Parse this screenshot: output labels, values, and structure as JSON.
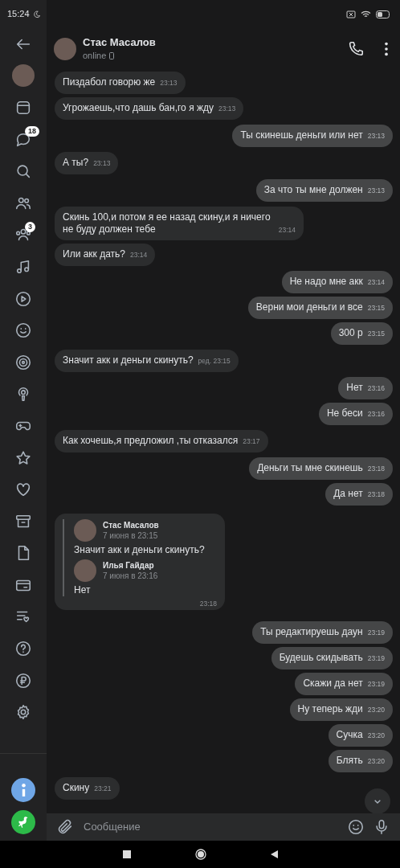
{
  "status_bar": {
    "time": "15:24"
  },
  "sidebar": {
    "items": [
      {
        "kind": "back"
      },
      {
        "kind": "avatar"
      },
      {
        "kind": "window"
      },
      {
        "kind": "chat",
        "badge": "18"
      },
      {
        "kind": "search"
      },
      {
        "kind": "people"
      },
      {
        "kind": "groups",
        "badge": "3"
      },
      {
        "kind": "music"
      },
      {
        "kind": "play"
      },
      {
        "kind": "smile"
      },
      {
        "kind": "target"
      },
      {
        "kind": "podcast"
      },
      {
        "kind": "gamepad"
      },
      {
        "kind": "star"
      },
      {
        "kind": "heart"
      },
      {
        "kind": "archive"
      },
      {
        "kind": "document"
      },
      {
        "kind": "card"
      },
      {
        "kind": "list"
      },
      {
        "kind": "question"
      },
      {
        "kind": "ruble"
      },
      {
        "kind": "gear"
      }
    ],
    "bottom_items": [
      {
        "kind": "info",
        "color": "#6fa6e6"
      },
      {
        "kind": "bird",
        "color": "#2dba49"
      }
    ]
  },
  "header": {
    "name": "Стас Масалов",
    "status": "online"
  },
  "messages": [
    {
      "outgoing": false,
      "text": "Пиздабол говорю же",
      "time": "23:13"
    },
    {
      "outgoing": false,
      "text": "Угрожаешь,что дашь бан,го я жду",
      "time": "23:13"
    },
    {
      "outgoing": true,
      "text": "Ты скинешь деньги или нет",
      "time": "23:13"
    },
    {
      "outgoing": false,
      "text": "А ты?",
      "time": "23:13"
    },
    {
      "outgoing": true,
      "text": "За что ты мне должен",
      "time": "23:13"
    },
    {
      "outgoing": false,
      "text": "Скинь 100,и потом я ее назад скину,и я ничего не буду должен тебе",
      "time": "23:14"
    },
    {
      "outgoing": false,
      "text": "Или акк дать?",
      "time": "23:14"
    },
    {
      "outgoing": true,
      "text": "Не надо мне акк",
      "time": "23:14"
    },
    {
      "outgoing": true,
      "text": "Верни мои деньги и все",
      "time": "23:15"
    },
    {
      "outgoing": true,
      "text": "300 р",
      "time": "23:15"
    },
    {
      "outgoing": false,
      "text": "Значит акк и деньги скинуть?",
      "time": "ред. 23:15"
    },
    {
      "outgoing": true,
      "text": "Нет",
      "time": "23:16"
    },
    {
      "outgoing": true,
      "text": "Не беси",
      "time": "23:16"
    },
    {
      "outgoing": false,
      "text": "Как хочешь,я предложил ,ты отказался",
      "time": "23:17"
    },
    {
      "outgoing": true,
      "text": "Деньги ты мне скинешь",
      "time": "23:18"
    },
    {
      "outgoing": true,
      "text": "Да нет",
      "time": "23:18"
    },
    {
      "outgoing": false,
      "time": "23:18",
      "forwarded": [
        {
          "author": "Стас Масалов",
          "date": "7 июня в 23:15",
          "text": "Значит акк и деньги скинуть?"
        },
        {
          "author": "Илья Гайдар",
          "date": "7 июня в 23:16",
          "text": "Нет"
        }
      ]
    },
    {
      "outgoing": true,
      "text": "Ты редактируешь даун",
      "time": "23:19"
    },
    {
      "outgoing": true,
      "text": "Будешь скидывать",
      "time": "23:19"
    },
    {
      "outgoing": true,
      "text": "Скажи да нет",
      "time": "23:19"
    },
    {
      "outgoing": true,
      "text": "Ну теперь жди",
      "time": "23:20"
    },
    {
      "outgoing": true,
      "text": "Сучка",
      "time": "23:20"
    },
    {
      "outgoing": true,
      "text": "Блять",
      "time": "23:20"
    },
    {
      "outgoing": false,
      "text": "Скину",
      "time": "23:21"
    }
  ],
  "composer": {
    "placeholder": "Сообщение"
  }
}
